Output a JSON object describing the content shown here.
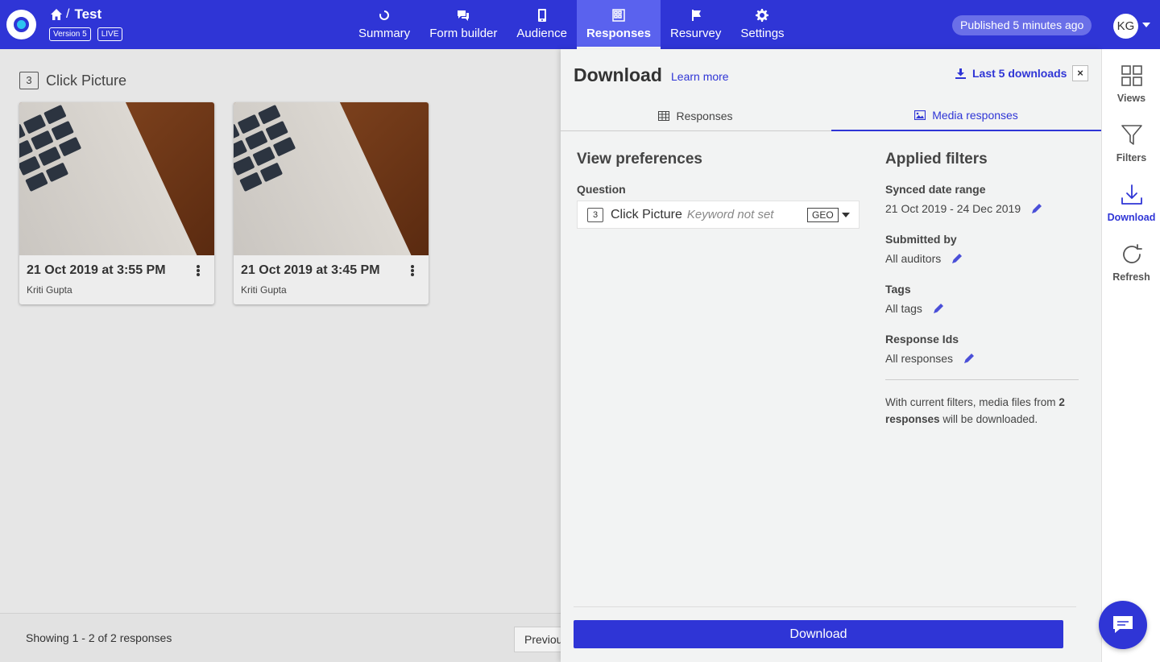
{
  "header": {
    "breadcrumb_title": "Test",
    "version_badge": "Version 5",
    "live_badge": "LIVE",
    "nav": [
      {
        "label": "Summary",
        "icon": "circle-arrows-icon"
      },
      {
        "label": "Form builder",
        "icon": "chat-bubbles-icon"
      },
      {
        "label": "Audience",
        "icon": "phone-icon"
      },
      {
        "label": "Responses",
        "icon": "grid-icon",
        "active": true
      },
      {
        "label": "Resurvey",
        "icon": "flag-icon"
      },
      {
        "label": "Settings",
        "icon": "gear-icon"
      }
    ],
    "published": "Published 5 minutes ago",
    "avatar_initials": "KG"
  },
  "gallery": {
    "question_number": "3",
    "question_title": "Click Picture",
    "cards": [
      {
        "date": "21 Oct 2019 at 3:55 PM",
        "author": "Kriti Gupta"
      },
      {
        "date": "21 Oct 2019 at 3:45 PM",
        "author": "Kriti Gupta"
      }
    ],
    "showing": "Showing 1 - 2 of 2 responses",
    "prev_label": "Previous"
  },
  "panel": {
    "title": "Download",
    "learn_more": "Learn more",
    "last_downloads": "Last 5 downloads",
    "close": "×",
    "tabs": [
      {
        "label": "Responses",
        "icon": "table-icon"
      },
      {
        "label": "Media responses",
        "icon": "image-icon",
        "active": true
      }
    ],
    "view_preferences": {
      "title": "View preferences",
      "question_label": "Question",
      "question_number": "3",
      "question_title": "Click Picture",
      "keyword": "Keyword not set",
      "geo_option": "GEO"
    },
    "applied_filters": {
      "title": "Applied filters",
      "filters": [
        {
          "label": "Synced date range",
          "value": "21 Oct 2019 - 24 Dec 2019"
        },
        {
          "label": "Submitted by",
          "value": "All auditors"
        },
        {
          "label": "Tags",
          "value": "All tags"
        },
        {
          "label": "Response Ids",
          "value": "All responses"
        }
      ],
      "summary_prefix": "With current filters, media files from",
      "summary_count": "2 responses",
      "summary_suffix": "will be downloaded."
    },
    "download_button": "Download"
  },
  "sidebar": {
    "items": [
      {
        "label": "Views",
        "icon": "views-grid-icon"
      },
      {
        "label": "Filters",
        "icon": "funnel-icon"
      },
      {
        "label": "Download",
        "icon": "download-icon",
        "active": true
      },
      {
        "label": "Refresh",
        "icon": "refresh-icon"
      }
    ]
  },
  "colors": {
    "brand": "#2f35d6",
    "nav_active": "#5a62ee",
    "panel_bg": "#f2f3f3"
  }
}
